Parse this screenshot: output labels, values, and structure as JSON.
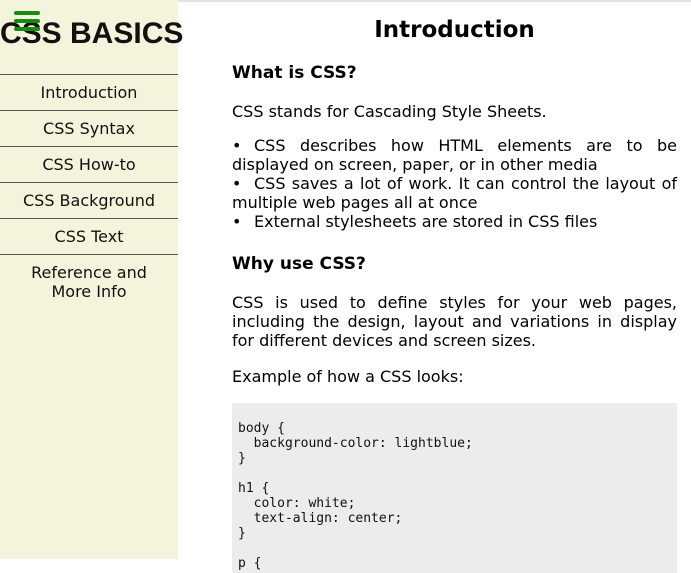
{
  "sidebar": {
    "title": "CSS BASICS",
    "menu_icon": "hamburger-menu-icon",
    "items": [
      {
        "label": "Introduction"
      },
      {
        "label": "CSS Syntax"
      },
      {
        "label": "CSS How-to"
      },
      {
        "label": "CSS Background"
      },
      {
        "label": "CSS Text"
      },
      {
        "label_line1": "Reference and",
        "label_line2": "More Info"
      }
    ]
  },
  "main": {
    "title": "Introduction",
    "section1": {
      "heading": "What is CSS?",
      "intro": "CSS stands for Cascading Style Sheets.",
      "bullets": [
        "CSS describes how HTML elements are to be displayed on screen, paper, or in other media",
        "CSS saves a lot of work. It can control the layout of multiple web pages all at once",
        "External stylesheets are stored in CSS files"
      ]
    },
    "section2": {
      "heading": "Why use CSS?",
      "paragraph": "CSS is used to define styles for your web pages, including the design, layout and variations in display for different devices and screen sizes.",
      "example_label": "Example of how a CSS looks:"
    },
    "code_example": "body {\n  background-color: lightblue;\n}\n\nh1 {\n  color: white;\n  text-align: center;\n}\n\np {"
  },
  "colors": {
    "sidebar_bg": "#f4f4dc",
    "menu_icon": "#188a12",
    "code_bg": "#ececea"
  }
}
